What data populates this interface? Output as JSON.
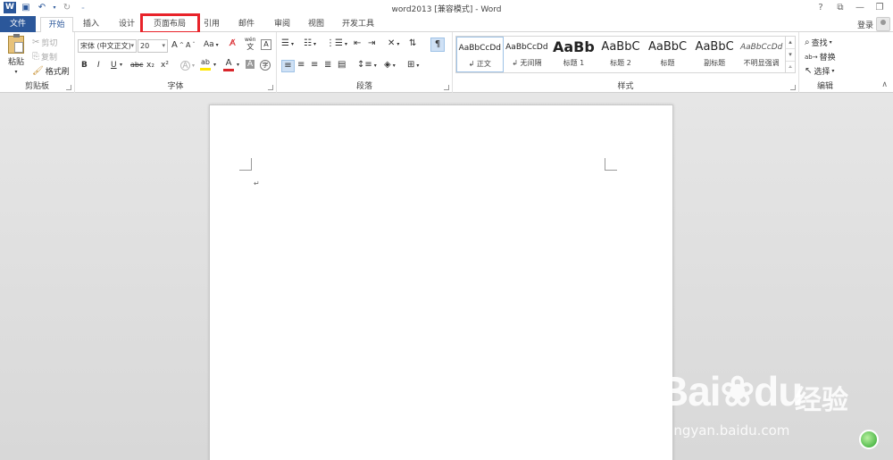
{
  "titlebar": {
    "app_logo": "W",
    "title": "word2013 [兼容模式] - Word",
    "qat_icons": [
      "save-icon",
      "undo-icon",
      "redo-icon",
      "customize-qat-icon"
    ],
    "window_controls": [
      "?",
      "⧉",
      "—",
      "❐"
    ]
  },
  "tabs": {
    "file": "文件",
    "items": [
      "开始",
      "插入",
      "设计",
      "页面布局",
      "引用",
      "邮件",
      "审阅",
      "视图",
      "开发工具"
    ],
    "active": "开始",
    "highlighted": "页面布局",
    "login": "登录"
  },
  "clipboard": {
    "label": "剪贴板",
    "paste": "粘贴",
    "cut": "剪切",
    "copy": "复制",
    "format_painter": "格式刷"
  },
  "font": {
    "label": "字体",
    "font_name": "宋体 (中文正文)",
    "font_size": "20",
    "grow": "A",
    "shrink": "A",
    "change_case": "Aa",
    "bold": "B",
    "italic": "I",
    "underline": "U",
    "strike": "abc",
    "subscript": "x₂",
    "superscript": "x²",
    "text_effects": "A",
    "highlight": "ab",
    "font_color": "A",
    "char_shading": "A",
    "enclose": "字",
    "phonetic": "wén",
    "char_border": "A",
    "accent_red": "#d9262b",
    "accent_yellow": "#ffe600"
  },
  "paragraph": {
    "label": "段落"
  },
  "styles": {
    "label": "样式",
    "items": [
      {
        "preview": "AaBbCcDd",
        "name": "↲ 正文",
        "selected": true
      },
      {
        "preview": "AaBbCcDd",
        "name": "↲ 无间隔",
        "selected": false
      },
      {
        "preview": "AaBb",
        "name": "标题 1",
        "selected": false
      },
      {
        "preview": "AaBbC",
        "name": "标题 2",
        "selected": false
      },
      {
        "preview": "AaBbC",
        "name": "标题",
        "selected": false
      },
      {
        "preview": "AaBbC",
        "name": "副标题",
        "selected": false
      },
      {
        "preview": "AaBbCcDd",
        "name": "不明显强调",
        "selected": false
      }
    ]
  },
  "editing": {
    "label": "编辑",
    "find": "查找",
    "replace": "替换",
    "select": "选择"
  },
  "document": {
    "paragraph_mark": "↵"
  },
  "watermark": {
    "brand": "Bai",
    "brand2": "du",
    "brand_cn": "经验",
    "url": "jingyan.baidu.com"
  }
}
